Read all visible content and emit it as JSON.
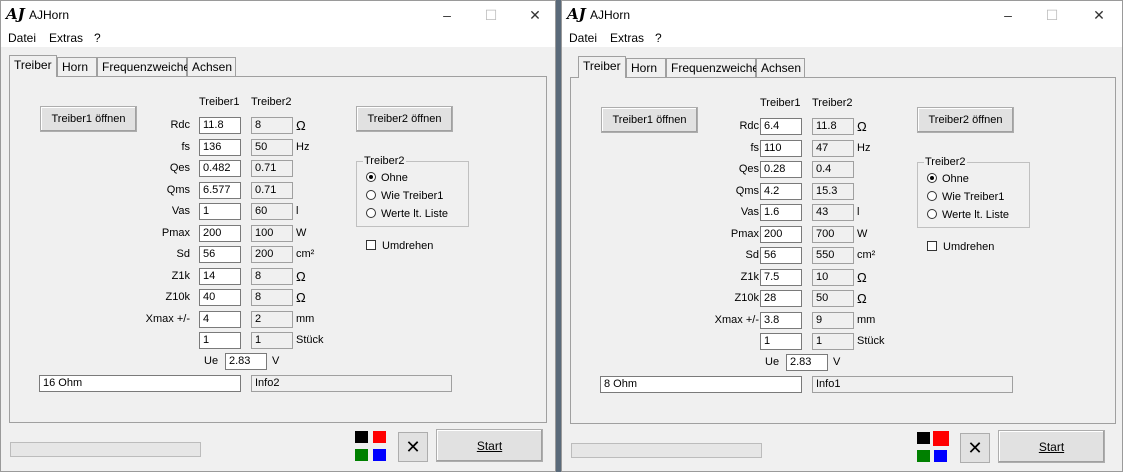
{
  "windows": [
    {
      "logo": "AJ",
      "title": "AJHorn",
      "menu": [
        "Datei",
        "Extras",
        "?"
      ],
      "tabs": [
        "Treiber",
        "Horn",
        "Frequenzweiche",
        "Achsen"
      ],
      "open1": "Treiber1 öffnen",
      "open2": "Treiber2 öffnen",
      "col1": "Treiber1",
      "col2": "Treiber2",
      "rows": [
        {
          "label": "Rdc",
          "v1": "11.8",
          "v2": "8",
          "unit": "Ω"
        },
        {
          "label": "fs",
          "v1": "136",
          "v2": "50",
          "unit": "Hz"
        },
        {
          "label": "Qes",
          "v1": "0.482",
          "v2": "0.71",
          "unit": ""
        },
        {
          "label": "Qms",
          "v1": "6.577",
          "v2": "0.71",
          "unit": ""
        },
        {
          "label": "Vas",
          "v1": "1",
          "v2": "60",
          "unit": "l"
        },
        {
          "label": "Pmax",
          "v1": "200",
          "v2": "100",
          "unit": "W"
        },
        {
          "label": "Sd",
          "v1": "56",
          "v2": "200",
          "unit": "cm²"
        },
        {
          "label": "Z1k",
          "v1": "14",
          "v2": "8",
          "unit": "Ω"
        },
        {
          "label": "Z10k",
          "v1": "40",
          "v2": "8",
          "unit": "Ω"
        },
        {
          "label": "Xmax +/-",
          "v1": "4",
          "v2": "2",
          "unit": "mm"
        },
        {
          "label": "",
          "v1": "1",
          "v2": "1",
          "unit": "Stück"
        }
      ],
      "ue_label": "Ue",
      "ue_value": "2.83",
      "ue_unit": "V",
      "info1": "16 Ohm",
      "info2": "Info2",
      "group_title": "Treiber2",
      "radio": [
        "Ohne",
        "Wie Treiber1",
        "Werte lt. Liste"
      ],
      "check": "Umdrehen",
      "start": "Start"
    },
    {
      "logo": "AJ",
      "title": "AJHorn",
      "menu": [
        "Datei",
        "Extras",
        "?"
      ],
      "tabs": [
        "Treiber",
        "Horn",
        "Frequenzweiche",
        "Achsen"
      ],
      "open1": "Treiber1 öffnen",
      "open2": "Treiber2 öffnen",
      "col1": "Treiber1",
      "col2": "Treiber2",
      "rows": [
        {
          "label": "Rdc",
          "v1": "6.4",
          "v2": "11.8",
          "unit": "Ω"
        },
        {
          "label": "fs",
          "v1": "110",
          "v2": "47",
          "unit": "Hz"
        },
        {
          "label": "Qes",
          "v1": "0.28",
          "v2": "0.4",
          "unit": ""
        },
        {
          "label": "Qms",
          "v1": "4.2",
          "v2": "15.3",
          "unit": ""
        },
        {
          "label": "Vas",
          "v1": "1.6",
          "v2": "43",
          "unit": "l"
        },
        {
          "label": "Pmax",
          "v1": "200",
          "v2": "700",
          "unit": "W"
        },
        {
          "label": "Sd",
          "v1": "56",
          "v2": "550",
          "unit": "cm²"
        },
        {
          "label": "Z1k",
          "v1": "7.5",
          "v2": "10",
          "unit": "Ω"
        },
        {
          "label": "Z10k",
          "v1": "28",
          "v2": "50",
          "unit": "Ω"
        },
        {
          "label": "Xmax +/-",
          "v1": "3.8",
          "v2": "9",
          "unit": "mm"
        },
        {
          "label": "",
          "v1": "1",
          "v2": "1",
          "unit": "Stück"
        }
      ],
      "ue_label": "Ue",
      "ue_value": "2.83",
      "ue_unit": "V",
      "info1": "8 Ohm",
      "info2": "Info1",
      "group_title": "Treiber2",
      "radio": [
        "Ohne",
        "Wie Treiber1",
        "Werte lt. Liste"
      ],
      "check": "Umdrehen",
      "start": "Start"
    }
  ],
  "colors": {
    "swatches": [
      "#000000",
      "#ff0000",
      "#008000",
      "#0000ff"
    ]
  }
}
